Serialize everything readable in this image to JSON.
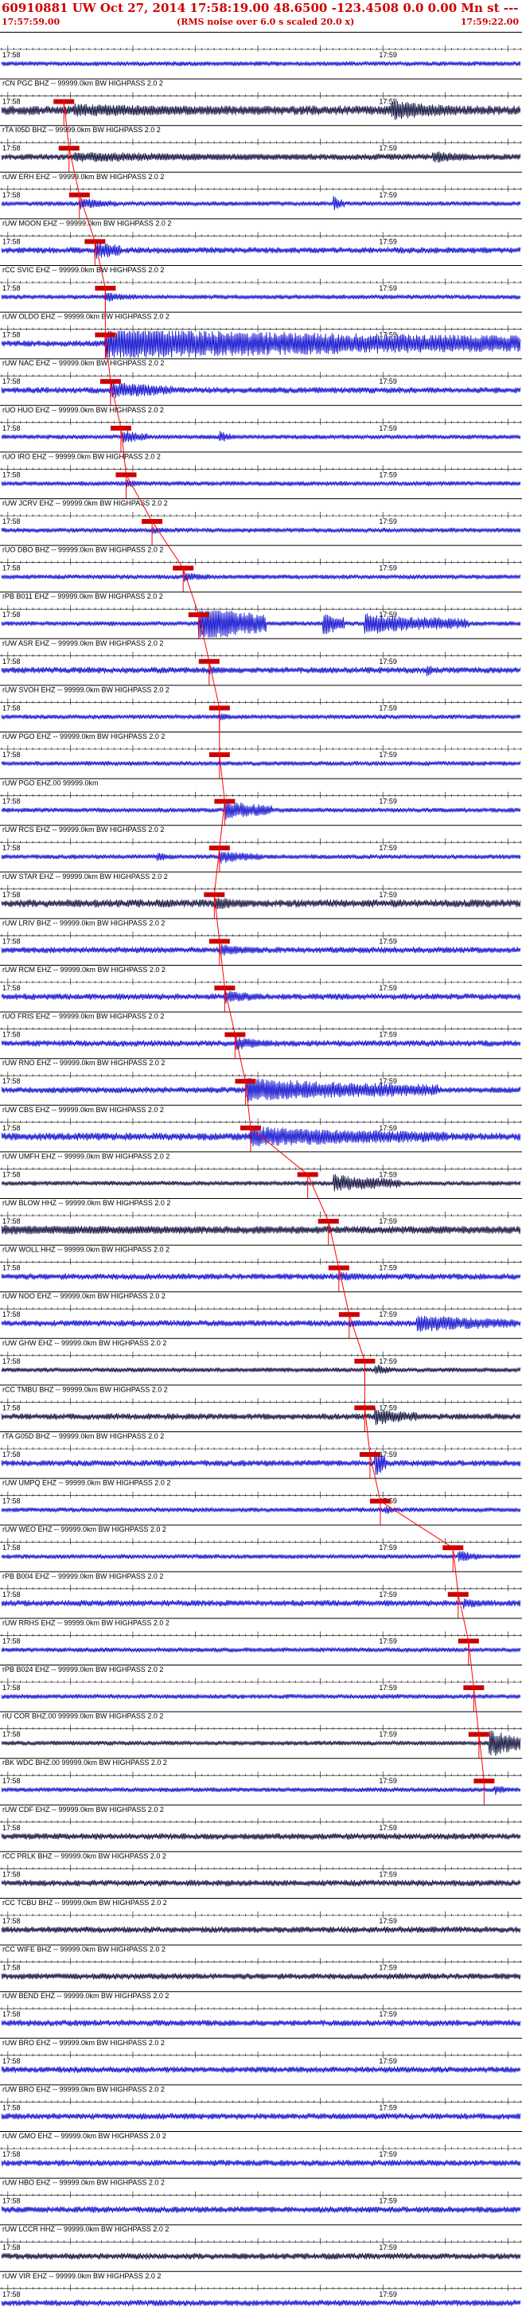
{
  "header": {
    "title": "60910881 UW Oct 27, 2014 17:58:19.00  48.6500 -123.4508  0.0 0.00 Mn st --- -- --  -1",
    "start_time": "17:57:59.00",
    "center_note": "(RMS noise over 6.0 s scaled 20.0 x)",
    "end_time": "17:59:22.00"
  },
  "chart_data": {
    "type": "line",
    "title": "60910881 UW Oct 27, 2014 17:58:19.00  48.6500 -123.4508  0.0 0.00 Mn st --- -- --  -1",
    "x_range_label": [
      "17:57:59.00",
      "17:59:22.00"
    ],
    "minute_ticks": [
      "17:58",
      "17:59"
    ],
    "grid": false,
    "colors": {
      "trace": "#0000cc",
      "trace_alt": "#000033",
      "pick": "#ff0000",
      "pick_label_bg": "#cc0000"
    },
    "traces": [
      {
        "label": "",
        "pick": null,
        "amp": 3,
        "bursts": []
      },
      {
        "label": "rCN PGC BHZ -- 99999.0km BW  HIGHPASS  2.0  2",
        "pick": 0.12,
        "amp": 6,
        "bursts": [
          [
            0.14,
            0.55,
            9
          ],
          [
            0.75,
            0.88,
            14
          ]
        ],
        "dark": true
      },
      {
        "label": "rTA I05D BHZ -- 99999.0km BW  HIGHPASS  2.0  2",
        "pick": 0.13,
        "amp": 4,
        "bursts": [
          [
            0.14,
            0.6,
            7
          ],
          [
            0.83,
            0.9,
            9
          ]
        ],
        "dark": true
      },
      {
        "label": "rUW ERH EHZ -- 99999.0km BW  HIGHPASS  2.0  2",
        "pick": 0.15,
        "amp": 3,
        "bursts": [
          [
            0.15,
            0.22,
            8
          ],
          [
            0.64,
            0.66,
            10
          ]
        ]
      },
      {
        "label": "rUW MOON EHZ -- 99999.0km BW  HIGHPASS  2.0  2",
        "pick": 0.18,
        "amp": 4,
        "bursts": [
          [
            0.18,
            0.23,
            14
          ]
        ]
      },
      {
        "label": "rCC SVIC EHZ -- 99999.0km BW  HIGHPASS  2.0  2",
        "pick": 0.2,
        "amp": 3,
        "bursts": [
          [
            0.2,
            0.26,
            7
          ]
        ]
      },
      {
        "label": "rUW OLDO EHZ -- 99999.0km BW  HIGHPASS  2.0  2",
        "pick": 0.2,
        "amp": 4,
        "bursts": [
          [
            0.2,
            1.0,
            22
          ]
        ]
      },
      {
        "label": "rUW NAC EHZ -- 99999.0km BW  HIGHPASS  2.0  2",
        "pick": 0.21,
        "amp": 4,
        "bursts": [
          [
            0.21,
            0.33,
            12
          ]
        ]
      },
      {
        "label": "rUO HUO EHZ -- 99999.0km BW  HIGHPASS  2.0  2",
        "pick": 0.23,
        "amp": 3,
        "bursts": [
          [
            0.23,
            0.28,
            10
          ],
          [
            0.42,
            0.44,
            9
          ]
        ]
      },
      {
        "label": "rUO IRO EHZ -- 99999.0km BW  HIGHPASS  2.0  2",
        "pick": 0.24,
        "amp": 3,
        "bursts": [
          [
            0.24,
            0.28,
            6
          ]
        ]
      },
      {
        "label": "rUW JCRV EHZ -- 99999.0km BW  HIGHPASS  2.0  2",
        "pick": 0.29,
        "amp": 3,
        "bursts": [
          [
            0.29,
            0.33,
            5
          ]
        ]
      },
      {
        "label": "rUO DBO BHZ -- 99999.0km BW  HIGHPASS  2.0  2",
        "pick": 0.35,
        "amp": 3,
        "bursts": [
          [
            0.35,
            0.4,
            7
          ]
        ]
      },
      {
        "label": "rPB B011 EHZ -- 99999.0km BW  HIGHPASS  2.0  2",
        "pick": 0.38,
        "amp": 3,
        "bursts": [
          [
            0.38,
            0.51,
            26
          ],
          [
            0.62,
            0.66,
            18
          ],
          [
            0.7,
            0.9,
            14
          ]
        ]
      },
      {
        "label": "rUW ASR EHZ -- 99999.0km BW  HIGHPASS  2.0  2",
        "pick": 0.4,
        "amp": 4,
        "bursts": [
          [
            0.4,
            0.45,
            6
          ],
          [
            0.82,
            0.84,
            8
          ]
        ]
      },
      {
        "label": "rUW SVOH EHZ -- 99999.0km BW  HIGHPASS  2.0  2",
        "pick": 0.42,
        "amp": 3,
        "bursts": [
          [
            0.42,
            0.46,
            5
          ]
        ]
      },
      {
        "label": "rUW PGO EHZ -- 99999.0km BW  HIGHPASS  2.0  2",
        "pick": 0.42,
        "amp": 3,
        "bursts": []
      },
      {
        "label": "rUW PGO EHZ.00 99999.0km",
        "pick": 0.43,
        "amp": 3,
        "bursts": [
          [
            0.43,
            0.52,
            14
          ]
        ]
      },
      {
        "label": "rUW RCS EHZ -- 99999.0km BW  HIGHPASS  2.0  2",
        "pick": 0.42,
        "amp": 3,
        "bursts": [
          [
            0.42,
            0.5,
            9
          ],
          [
            0.3,
            0.34,
            6
          ]
        ]
      },
      {
        "label": "rUW STAR EHZ -- 99999.0km BW  HIGHPASS  2.0  2",
        "pick": 0.41,
        "amp": 5,
        "bursts": [
          [
            0.41,
            0.48,
            9
          ]
        ],
        "dark": true
      },
      {
        "label": "rUW LRIV BHZ -- 99999.0km BW  HIGHPASS  2.0  2",
        "pick": 0.42,
        "amp": 4,
        "bursts": [
          [
            0.42,
            0.5,
            8
          ]
        ]
      },
      {
        "label": "rUW RCM EHZ -- 99999.0km BW  HIGHPASS  2.0  2",
        "pick": 0.43,
        "amp": 4,
        "bursts": [
          [
            0.43,
            0.5,
            9
          ]
        ]
      },
      {
        "label": "rUO FRIS EHZ -- 99999.0km BW  HIGHPASS  2.0  2",
        "pick": 0.45,
        "amp": 4,
        "bursts": [
          [
            0.45,
            0.52,
            9
          ]
        ]
      },
      {
        "label": "rUW RNO EHZ -- 99999.0km BW  HIGHPASS  2.0  2",
        "pick": 0.47,
        "amp": 4,
        "bursts": [
          [
            0.47,
            0.84,
            16
          ]
        ]
      },
      {
        "label": "rUW CBS EHZ -- 99999.0km BW  HIGHPASS  2.0  2",
        "pick": 0.48,
        "amp": 5,
        "bursts": [
          [
            0.48,
            0.86,
            14
          ]
        ]
      },
      {
        "label": "rUW UMFH EHZ -- 99999.0km BW  HIGHPASS  2.0  2",
        "pick": 0.59,
        "amp": 3,
        "bursts": [
          [
            0.64,
            0.77,
            12
          ]
        ],
        "dark": true
      },
      {
        "label": "rUW BLOW HHZ -- 99999.0km BW  HIGHPASS  2.0  2",
        "pick": 0.63,
        "amp": 5,
        "bursts": [
          [
            0.0,
            1.0,
            6
          ]
        ],
        "dark": true
      },
      {
        "label": "rUW WOLL HHZ -- 99999.0km BW  HIGHPASS  2.0  2",
        "pick": 0.65,
        "amp": 4,
        "bursts": [
          [
            0.65,
            0.75,
            6
          ]
        ]
      },
      {
        "label": "rUW NOO EHZ -- 99999.0km BW  HIGHPASS  2.0  2",
        "pick": 0.67,
        "amp": 4,
        "bursts": [
          [
            0.67,
            0.72,
            6
          ],
          [
            0.8,
            0.99,
            12
          ]
        ]
      },
      {
        "label": "rUW GHW EHZ -- 99999.0km BW  HIGHPASS  2.0  2",
        "pick": 0.7,
        "amp": 3,
        "bursts": [
          [
            0.72,
            0.75,
            8
          ]
        ],
        "dark": true
      },
      {
        "label": "rCC TMBU BHZ -- 99999.0km BW  HIGHPASS  2.0  2",
        "pick": 0.7,
        "amp": 4,
        "bursts": [
          [
            0.72,
            0.8,
            12
          ]
        ],
        "dark": true
      },
      {
        "label": "rTA G05D BHZ -- 99999.0km BW  HIGHPASS  2.0  2",
        "pick": 0.71,
        "amp": 4,
        "bursts": [
          [
            0.72,
            0.74,
            20
          ]
        ]
      },
      {
        "label": "rUW UMPQ EHZ -- 99999.0km BW  HIGHPASS  2.0  2",
        "pick": 0.73,
        "amp": 3,
        "bursts": [
          [
            0.74,
            0.76,
            6
          ]
        ]
      },
      {
        "label": "rUW WEO EHZ -- 99999.0km BW  HIGHPASS  2.0  2",
        "pick": 0.87,
        "amp": 3,
        "bursts": [
          [
            0.88,
            0.92,
            9
          ]
        ]
      },
      {
        "label": "rPB B004 EHZ -- 99999.0km BW  HIGHPASS  2.0  2",
        "pick": 0.88,
        "amp": 4,
        "bursts": [
          [
            0.89,
            0.93,
            8
          ]
        ]
      },
      {
        "label": "rUW RRHS EHZ -- 99999.0km BW  HIGHPASS  2.0  2",
        "pick": 0.9,
        "amp": 3,
        "bursts": []
      },
      {
        "label": "rPB B024 EHZ -- 99999.0km BW  HIGHPASS  2.0  2",
        "pick": 0.91,
        "amp": 3,
        "bursts": []
      },
      {
        "label": "rIU COR BHZ.00 99999.0km BW  HIGHPASS  2.0  2",
        "pick": 0.92,
        "amp": 3,
        "bursts": [
          [
            0.94,
            1.0,
            20
          ]
        ],
        "dark": true
      },
      {
        "label": "rBK WDC BHZ.00 99999.0km BW  HIGHPASS  2.0  2",
        "pick": 0.93,
        "amp": 3,
        "bursts": [
          [
            0.95,
            0.97,
            8
          ]
        ]
      },
      {
        "label": "rUW CDF EHZ -- 99999.0km BW  HIGHPASS  2.0  2",
        "pick": null,
        "amp": 4,
        "bursts": [],
        "dark": true
      },
      {
        "label": "rCC PRLK BHZ -- 99999.0km BW  HIGHPASS  2.0  2",
        "pick": null,
        "amp": 4,
        "bursts": [],
        "dark": true
      },
      {
        "label": "rCC TCBU BHZ -- 99999.0km BW  HIGHPASS  2.0  2",
        "pick": null,
        "amp": 4,
        "bursts": [],
        "dark": true
      },
      {
        "label": "rCC WIFE BHZ -- 99999.0km BW  HIGHPASS  2.0  2",
        "pick": null,
        "amp": 4,
        "bursts": [],
        "dark": true
      },
      {
        "label": "rUW BEND EHZ -- 99999.0km BW  HIGHPASS  2.0  2",
        "pick": null,
        "amp": 4,
        "bursts": []
      },
      {
        "label": "rUW BRO EHZ -- 99999.0km BW  HIGHPASS  2.0  2",
        "pick": null,
        "amp": 4,
        "bursts": []
      },
      {
        "label": "rUW BRO EHZ -- 99999.0km BW  HIGHPASS  2.0  2",
        "pick": null,
        "amp": 4,
        "bursts": []
      },
      {
        "label": "rUW GMO EHZ -- 99999.0km BW  HIGHPASS  2.0  2",
        "pick": null,
        "amp": 4,
        "bursts": []
      },
      {
        "label": "rUW HBO EHZ -- 99999.0km BW  HIGHPASS  2.0  2",
        "pick": null,
        "amp": 4,
        "bursts": []
      },
      {
        "label": "rUW LCCR HHZ -- 99999.0km BW  HIGHPASS  2.0  2",
        "pick": null,
        "amp": 4,
        "bursts": [],
        "dark": true
      },
      {
        "label": "rUW VIR EHZ -- 99999.0km BW  HIGHPASS  2.0  2",
        "pick": null,
        "amp": 4,
        "bursts": []
      }
    ]
  }
}
